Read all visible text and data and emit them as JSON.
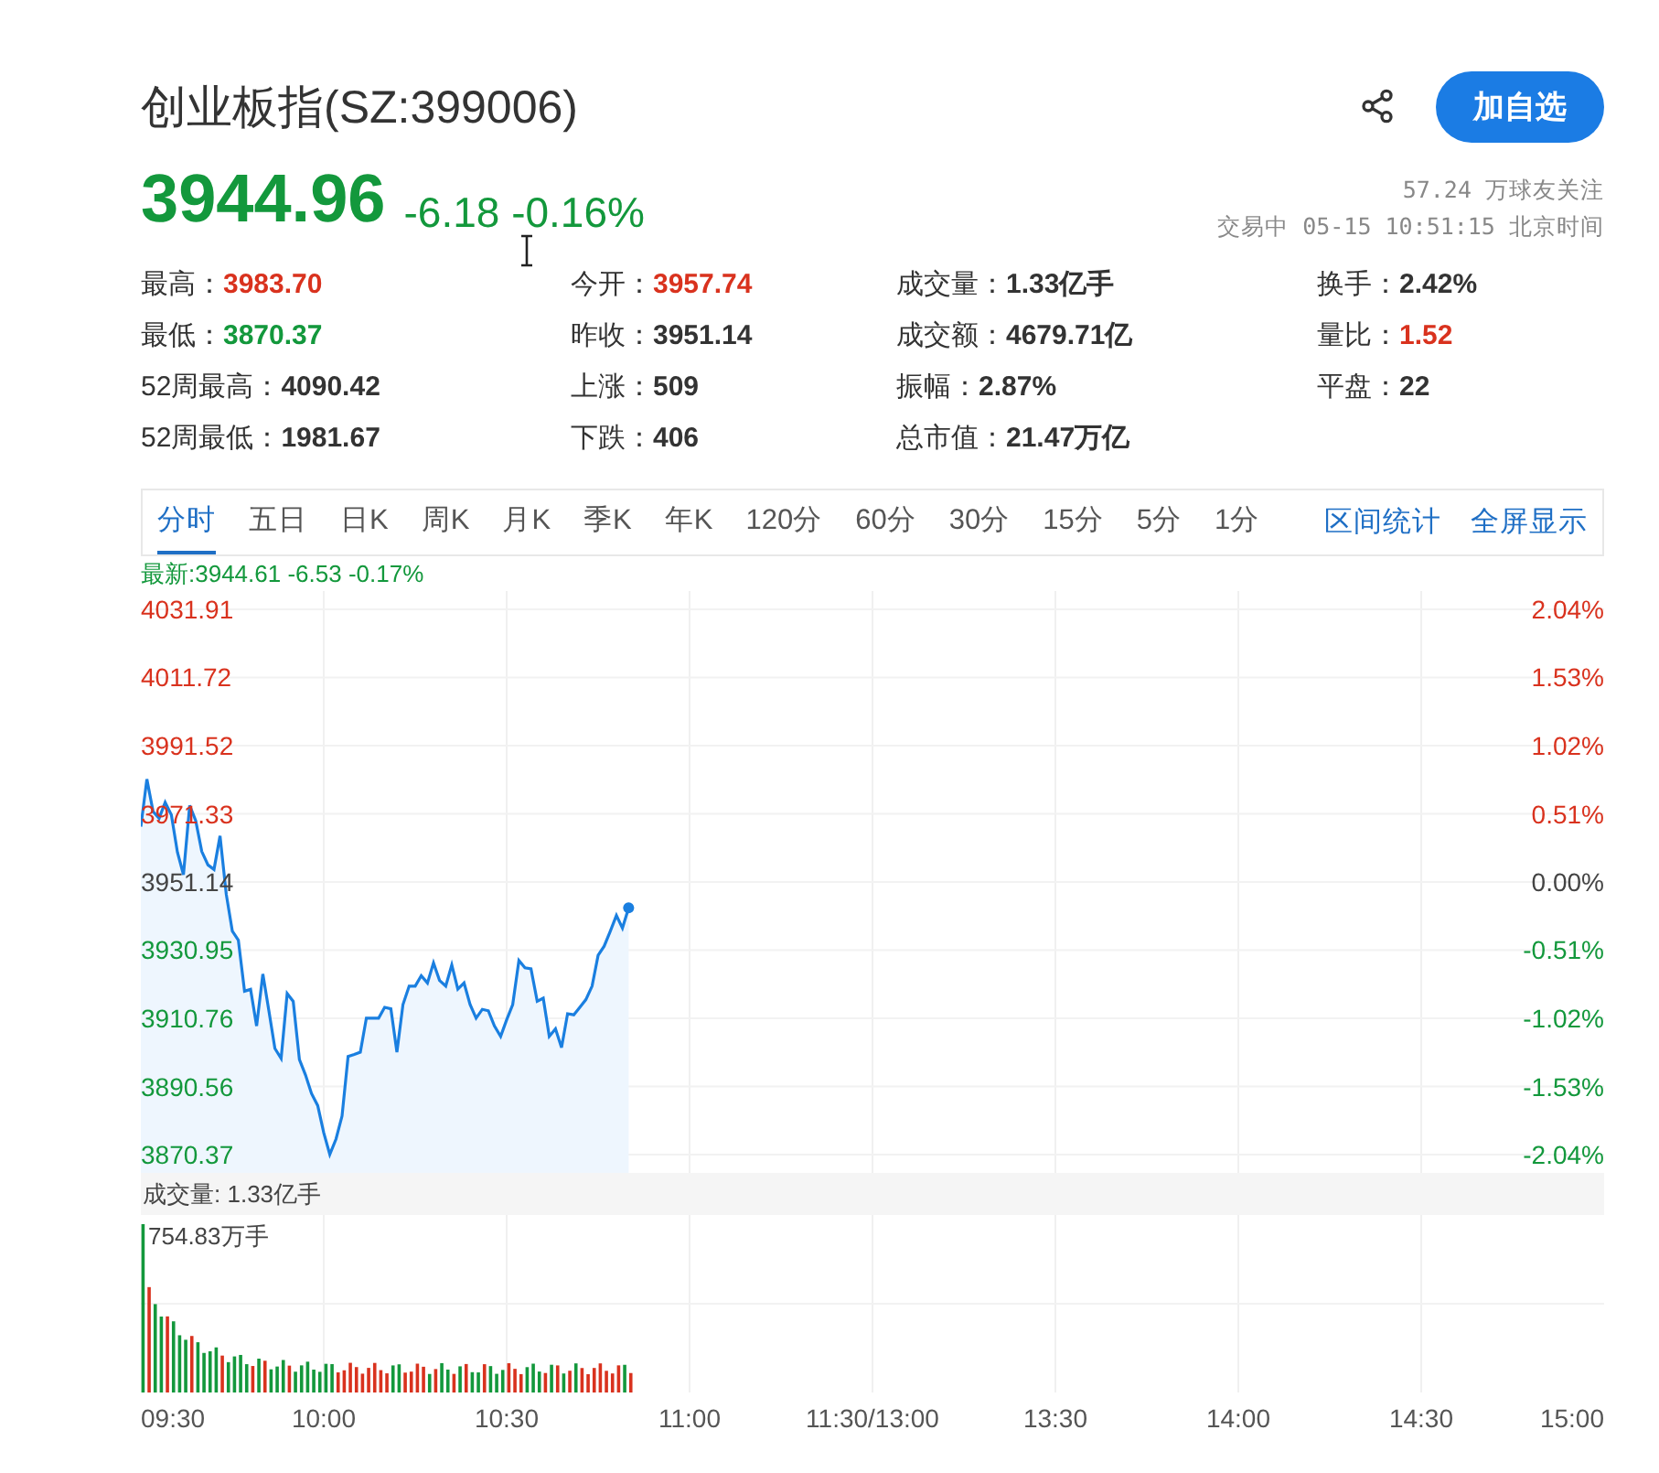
{
  "header": {
    "title": "创业板指(SZ:399006)",
    "follow_button": "加自选"
  },
  "quote": {
    "price": "3944.96",
    "change": "-6.18 -0.16%",
    "followers": "57.24 万球友关注",
    "status": "交易中 05-15 10:51:15 北京时间"
  },
  "stats": [
    {
      "label": "最高：",
      "value": "3983.70",
      "color": "#d9321e"
    },
    {
      "label": "今开：",
      "value": "3957.74",
      "color": "#d9321e"
    },
    {
      "label": "成交量：",
      "value": "1.33亿手",
      "color": "#333333"
    },
    {
      "label": "换手：",
      "value": "2.42%",
      "color": "#333333"
    },
    {
      "label": "最低：",
      "value": "3870.37",
      "color": "#13983c"
    },
    {
      "label": "昨收：",
      "value": "3951.14",
      "color": "#333333"
    },
    {
      "label": "成交额：",
      "value": "4679.71亿",
      "color": "#333333"
    },
    {
      "label": "量比：",
      "value": "1.52",
      "color": "#d9321e"
    },
    {
      "label": "52周最高：",
      "value": "4090.42",
      "color": "#333333"
    },
    {
      "label": "上涨：",
      "value": "509",
      "color": "#333333"
    },
    {
      "label": "振幅：",
      "value": "2.87%",
      "color": "#333333"
    },
    {
      "label": "平盘：",
      "value": "22",
      "color": "#333333"
    },
    {
      "label": "52周最低：",
      "value": "1981.67",
      "color": "#333333"
    },
    {
      "label": "下跌：",
      "value": "406",
      "color": "#333333"
    },
    {
      "label": "总市值：",
      "value": "21.47万亿",
      "color": "#333333"
    }
  ],
  "tabs": [
    {
      "label": "分时",
      "selected": true
    },
    {
      "label": "五日",
      "selected": false
    },
    {
      "label": "日K",
      "selected": false
    },
    {
      "label": "周K",
      "selected": false
    },
    {
      "label": "月K",
      "selected": false
    },
    {
      "label": "季K",
      "selected": false
    },
    {
      "label": "年K",
      "selected": false
    },
    {
      "label": "120分",
      "selected": false
    },
    {
      "label": "60分",
      "selected": false
    },
    {
      "label": "30分",
      "selected": false
    },
    {
      "label": "15分",
      "selected": false
    },
    {
      "label": "5分",
      "selected": false
    },
    {
      "label": "1分",
      "selected": false
    }
  ],
  "tab_links": [
    "区间统计",
    "全屏显示"
  ],
  "chart": {
    "latest": "最新:3944.61 -6.53 -0.17%",
    "percent_ticks": [
      "2.04%",
      "1.53%",
      "1.02%",
      "0.51%",
      "0.00%",
      "-0.51%",
      "-1.02%",
      "-1.53%",
      "-2.04%"
    ],
    "chart_data": {
      "type": "line",
      "grid": true,
      "ylim": [
        3870.37,
        4031.91
      ],
      "yticks": [
        4031.91,
        4011.72,
        3991.52,
        3971.33,
        3951.14,
        3930.95,
        3910.76,
        3890.56,
        3870.37
      ],
      "series": [
        {
          "color": "#1a7fe0",
          "values": [
            3967.5,
            3981.6,
            3972,
            3970,
            3974.7,
            3971,
            3960,
            3953.3,
            3973.8,
            3969.3,
            3960.2,
            3956.2,
            3954.8,
            3964.8,
            3947.5,
            3936.6,
            3933.9,
            3918.8,
            3919.3,
            3908.5,
            3923.9,
            3913,
            3901.8,
            3898.9,
            3918.1,
            3915.8,
            3898.5,
            3894,
            3888.5,
            3884.9,
            3876.8,
            3870.4,
            3875,
            3881.8,
            3899.4,
            3900,
            3900.7,
            3910.8,
            3910.8,
            3910.8,
            3914,
            3913.6,
            3900.7,
            3914.8,
            3920.3,
            3920.3,
            3923.4,
            3921.2,
            3927.2,
            3922,
            3920.3,
            3926.6,
            3919.4,
            3921.2,
            3914.8,
            3910.8,
            3913.4,
            3913,
            3908.5,
            3905.4,
            3910.3,
            3914.8,
            3927.9,
            3925.7,
            3925.4,
            3915.8,
            3916.7,
            3905.4,
            3907.6,
            3902.1,
            3912.1,
            3911.8,
            3914,
            3916.3,
            3920.3,
            3929.4,
            3932.1,
            3936.6,
            3941.2,
            3937.5,
            3943.5,
            null,
            null,
            null,
            null,
            null,
            null,
            null,
            null,
            null,
            null,
            null,
            null,
            null,
            null,
            null,
            null,
            null,
            null,
            null,
            null,
            null,
            null,
            null,
            null,
            null,
            null,
            null,
            null,
            null,
            null,
            null,
            null,
            null,
            null,
            null,
            null,
            null,
            null,
            null,
            null,
            null,
            null,
            null,
            null,
            null,
            null,
            null,
            null,
            null,
            null,
            null,
            null,
            null,
            null,
            null,
            null,
            null,
            null,
            null,
            null,
            null,
            null,
            null,
            null,
            null,
            null,
            null,
            null,
            null,
            null,
            null,
            null,
            null,
            null,
            null,
            null,
            null,
            null,
            null,
            null,
            null,
            null,
            null,
            null,
            null,
            null,
            null,
            null,
            null,
            null,
            null,
            null,
            null,
            null,
            null,
            null,
            null,
            null,
            null,
            null,
            null,
            null,
            null,
            null,
            null,
            null,
            null,
            null,
            null,
            null,
            null,
            null,
            null,
            null,
            null,
            null,
            null,
            null,
            null,
            null,
            null,
            null,
            null,
            null,
            null,
            null,
            null,
            null,
            null,
            null,
            null,
            null,
            null,
            null,
            null,
            null,
            null,
            null,
            null,
            null,
            null,
            null,
            null,
            null,
            null,
            null,
            null,
            null,
            null,
            null,
            null,
            null,
            null,
            null,
            null,
            null,
            null,
            null,
            null,
            null
          ]
        }
      ]
    }
  },
  "volume": {
    "label": "成交量: 1.33亿手",
    "max_label": "754.83万手",
    "time_axis": [
      "09:30",
      "10:00",
      "10:30",
      "11:00",
      "11:30/13:00",
      "13:30",
      "14:00",
      "14:30",
      "15:00"
    ]
  }
}
